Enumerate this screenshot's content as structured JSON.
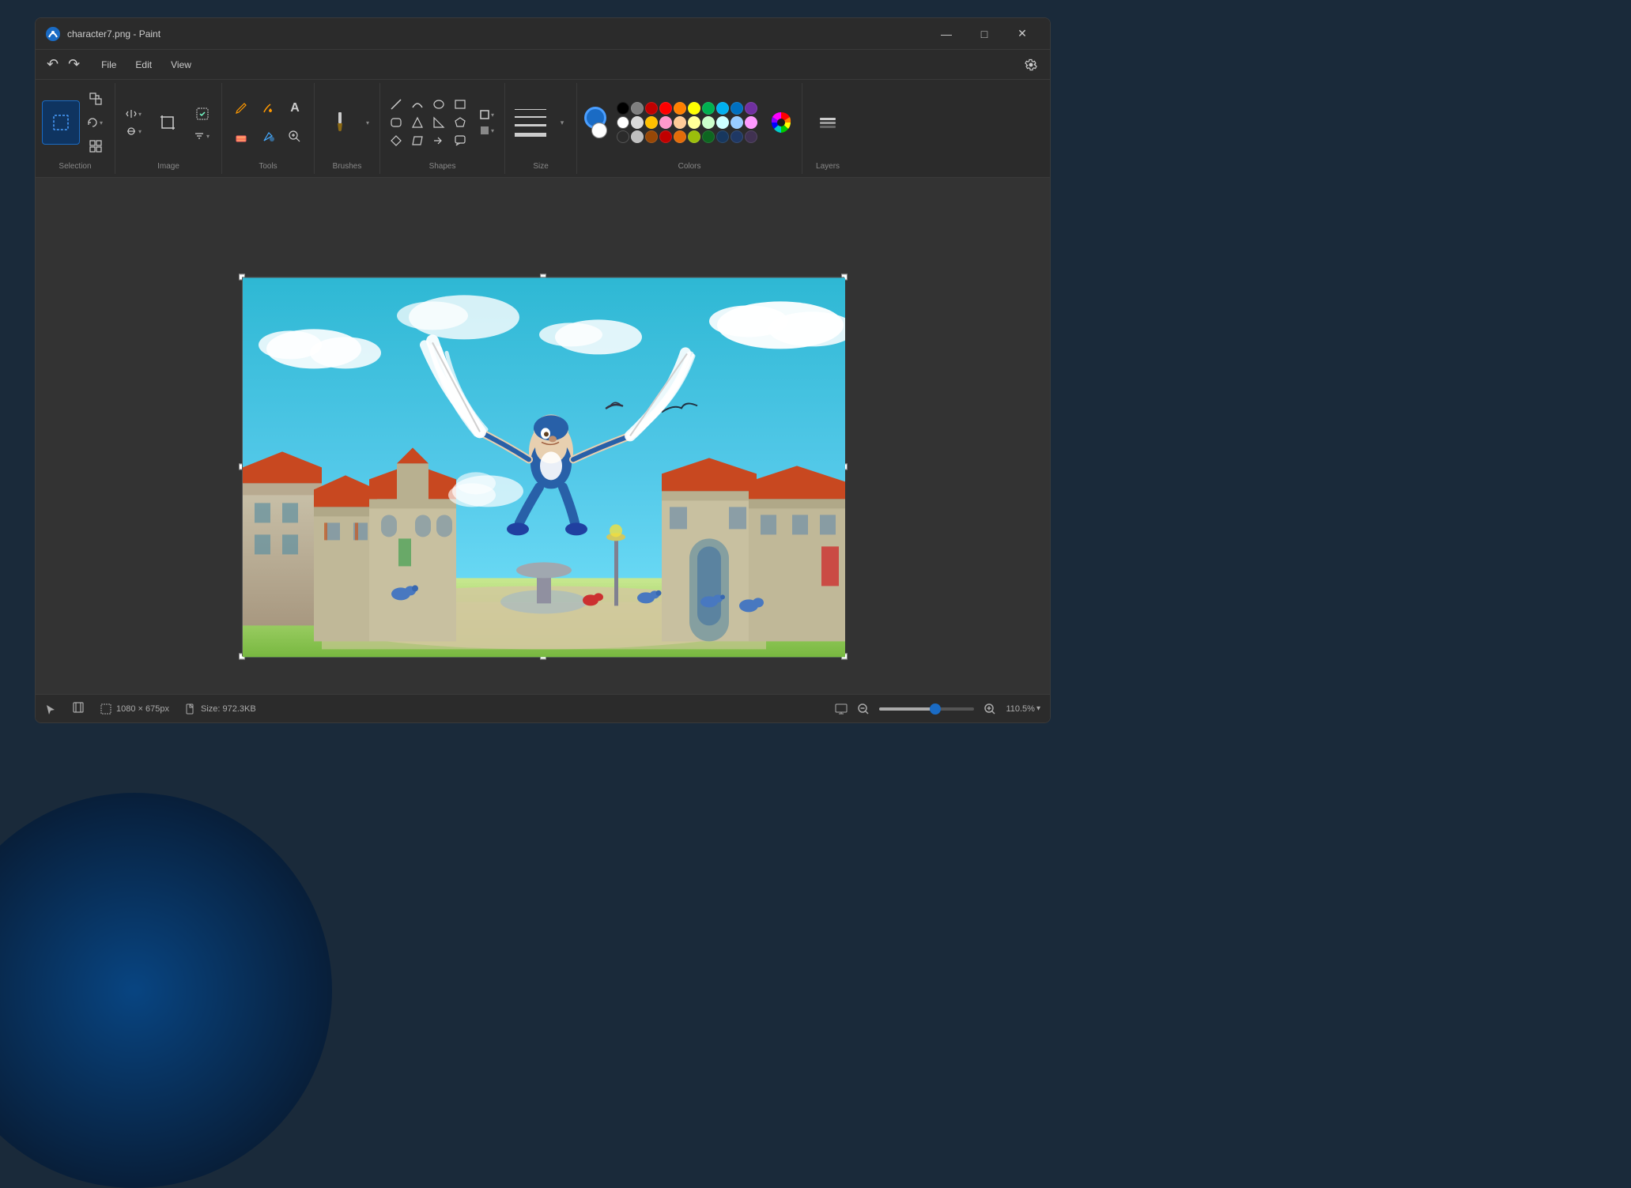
{
  "window": {
    "title": "character7.png - Paint",
    "icon": "🎨"
  },
  "titlebar": {
    "title": "character7.png - Paint",
    "minimize_label": "—",
    "maximize_label": "□",
    "close_label": "✕"
  },
  "menu": {
    "items": [
      "File",
      "Edit",
      "View"
    ]
  },
  "ribbon": {
    "groups": {
      "selection": {
        "label": "Selection"
      },
      "image": {
        "label": "Image"
      },
      "tools": {
        "label": "Tools"
      },
      "brushes": {
        "label": "Brushes"
      },
      "shapes": {
        "label": "Shapes"
      },
      "size": {
        "label": "Size"
      },
      "colors": {
        "label": "Colors"
      },
      "layers": {
        "label": "Layers"
      }
    }
  },
  "colors": {
    "swatches_row1": [
      "#000000",
      "#7f7f7f",
      "#c00000",
      "#ff0000",
      "#ff7f00",
      "#ffff00",
      "#00b050",
      "#00b0f0",
      "#0070c0",
      "#7030a0"
    ],
    "swatches_row2": [
      "#ffffff",
      "#d9d9d9",
      "#ffc000",
      "#ff99cc",
      "#ffcc99",
      "#ffff99",
      "#ccffcc",
      "#ccffff",
      "#99ccff",
      "#ff99ff"
    ],
    "swatches_row3": [
      "#transparent",
      "#bfbfbf",
      "#974706",
      "#c00000",
      "#e36c09",
      "#9bbe0b",
      "#0e6620",
      "#17375e",
      "#17375e",
      "#403151"
    ],
    "active_color": "#1a6bc4"
  },
  "statusbar": {
    "dimensions": "1080 × 675px",
    "size": "Size: 972.3KB",
    "zoom": "110.5%"
  },
  "layers_panel": {
    "label": "Layers"
  },
  "cursor": {
    "position_label": "↖"
  }
}
